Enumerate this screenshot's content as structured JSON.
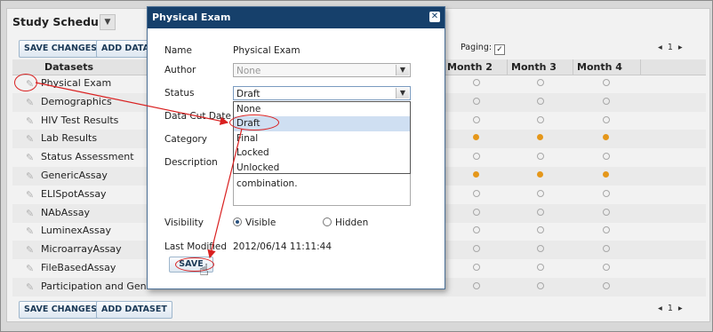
{
  "panel": {
    "title": "Study Schedule",
    "title_dropdown_icon": "chevron-down-icon",
    "save_changes": "SAVE CHANGES",
    "add_dataset": "ADD DATASET",
    "add_dataset_cut": "ADD DATAS",
    "paging_label": "Paging:",
    "paging_checked": true,
    "pager_prev": "◂",
    "pager_page": "1",
    "pager_next": "▸"
  },
  "grid": {
    "columns": [
      "Datasets",
      "Month 2",
      "Month 3",
      "Month 4"
    ],
    "rows": [
      {
        "name": "Physical Exam",
        "m2": "empty",
        "m3": "empty",
        "m4": "empty"
      },
      {
        "name": "Demographics",
        "m2": "empty",
        "m3": "empty",
        "m4": "empty"
      },
      {
        "name": "HIV Test Results",
        "m2": "empty",
        "m3": "empty",
        "m4": "empty"
      },
      {
        "name": "Lab Results",
        "m2": "full",
        "m3": "full",
        "m4": "full"
      },
      {
        "name": "Status Assessment",
        "m2": "empty",
        "m3": "empty",
        "m4": "empty"
      },
      {
        "name": "GenericAssay",
        "m2": "full",
        "m3": "full",
        "m4": "full"
      },
      {
        "name": "ELISpotAssay",
        "m2": "empty",
        "m3": "empty",
        "m4": "empty"
      },
      {
        "name": "NAbAssay",
        "m2": "empty",
        "m3": "empty",
        "m4": "empty"
      },
      {
        "name": "LuminexAssay",
        "m2": "empty",
        "m3": "empty",
        "m4": "empty"
      },
      {
        "name": "MicroarrayAssay",
        "m2": "empty",
        "m3": "empty",
        "m4": "empty"
      },
      {
        "name": "FileBasedAssay",
        "m2": "empty",
        "m3": "empty",
        "m4": "empty"
      },
      {
        "name": "Participation and Genet",
        "m2": "empty",
        "m3": "empty",
        "m4": "empty"
      }
    ]
  },
  "dialog": {
    "title": "Physical Exam",
    "close_icon": "close-icon",
    "labels": {
      "name": "Name",
      "author": "Author",
      "status": "Status",
      "data_cut_date": "Data Cut Date",
      "category": "Category",
      "description": "Description",
      "visibility": "Visibility",
      "last_modified": "Last Modified"
    },
    "name_value": "Physical Exam",
    "author_value": "None",
    "status_value": "Draft",
    "status_options": [
      "None",
      "Draft",
      "Final",
      "Locked",
      "Unlocked"
    ],
    "description_tail": "combination.",
    "visibility_visible": "Visible",
    "visibility_hidden": "Hidden",
    "last_modified_value": "2012/06/14 11:11:44",
    "save": "SAVE"
  },
  "colors": {
    "dialog_title_bg": "#16406b",
    "annotation": "#d92020",
    "dot_full": "#e5971a"
  }
}
